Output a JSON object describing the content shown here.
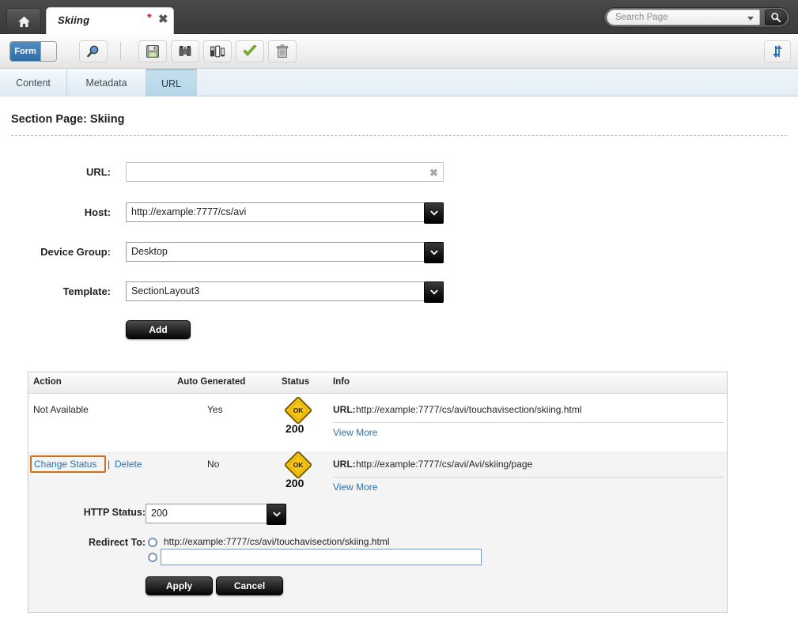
{
  "window": {
    "home_tab_icon": "home-icon",
    "doc_tab": {
      "title": "Skiing",
      "dirty_marker": "*",
      "close_label": "✖"
    }
  },
  "search": {
    "placeholder": "Search Page",
    "value": "",
    "dropdown_icon": "chevron-down-icon",
    "button_icon": "search-icon"
  },
  "toolbar": {
    "mode_toggle": {
      "label": "Form",
      "state": "on"
    },
    "preview_icon": "magnifier-icon",
    "buttons": [
      {
        "name": "save-button",
        "icon": "floppy-disk-icon"
      },
      {
        "name": "inspect-button",
        "icon": "binoculars-icon"
      },
      {
        "name": "devices-button",
        "icon": "devices-icon"
      },
      {
        "name": "approve-button",
        "icon": "checkmark-icon"
      },
      {
        "name": "delete-button",
        "icon": "trash-icon"
      }
    ],
    "refresh_icon": "refresh-arrows-icon"
  },
  "tabs": [
    {
      "label": "Content",
      "active": false
    },
    {
      "label": "Metadata",
      "active": false
    },
    {
      "label": "URL",
      "active": true
    }
  ],
  "page": {
    "title": "Section Page: Skiing"
  },
  "form": {
    "url": {
      "label": "URL:",
      "value": "",
      "clear_icon": "✖"
    },
    "host": {
      "label": "Host:",
      "value": "http://example:7777/cs/avi"
    },
    "device_group": {
      "label": "Device Group:",
      "value": "Desktop"
    },
    "template": {
      "label": "Template:",
      "value": "SectionLayout3"
    },
    "add_button": "Add"
  },
  "table": {
    "headers": [
      "Action",
      "Auto Generated",
      "Status",
      "Info"
    ],
    "rows": [
      {
        "actions": [
          {
            "label": "Not Available",
            "link": false,
            "highlighted": false
          }
        ],
        "auto_generated": "No",
        "status_badge": "OK",
        "status_code": "200",
        "info_label": "URL:",
        "info_url": "http://example:7777/cs/avi/touchavisection/skiing.html",
        "view_more": "View More"
      },
      {
        "actions": [
          {
            "label": "Change Status",
            "link": true,
            "highlighted": true
          },
          {
            "label": "|",
            "link": false,
            "highlighted": false
          },
          {
            "label": "Delete",
            "link": true,
            "highlighted": false
          }
        ],
        "auto_generated": "No",
        "status_badge": "OK",
        "status_code": "200",
        "info_label": "URL:",
        "info_url": "http://example:7777/cs/avi/Avi/skiing/page",
        "view_more": "View More"
      }
    ],
    "row1_auto_generated": "Yes"
  },
  "edit_panel": {
    "http_status": {
      "label": "HTTP Status:",
      "value": "200"
    },
    "redirect_to": {
      "label": "Redirect To:",
      "option1": "http://example:7777/cs/avi/touchavisection/skiing.html",
      "option2_value": "",
      "selected": "none"
    },
    "apply_button": "Apply",
    "cancel_button": "Cancel"
  },
  "colors": {
    "accent_blue": "#2f6da5",
    "link_blue": "#2a72ab",
    "highlight_orange": "#d2701a",
    "status_yellow": "#f5c518",
    "approve_green": "#7ab227"
  }
}
